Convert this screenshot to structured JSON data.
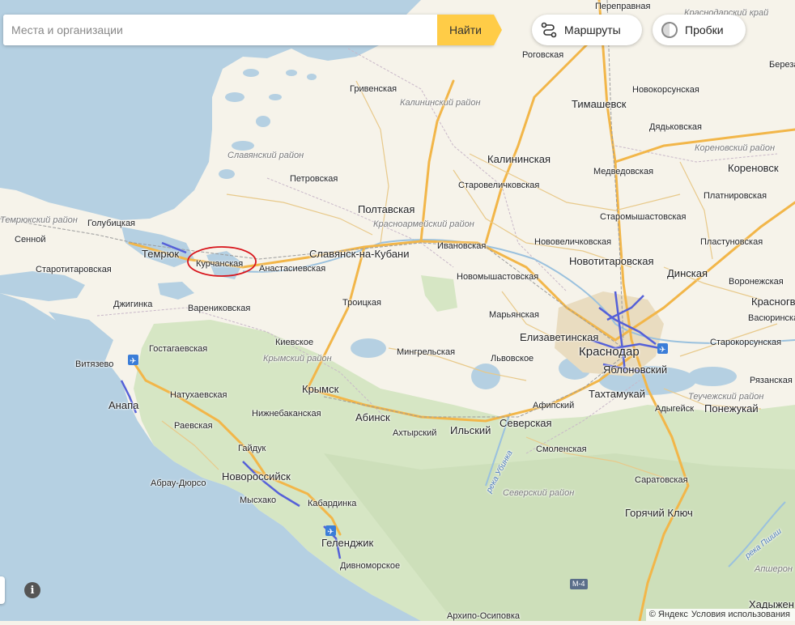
{
  "search": {
    "placeholder": "Места и организации",
    "button_label": "Найти"
  },
  "controls": {
    "routes_label": "Маршруты",
    "traffic_label": "Пробки",
    "routes_icon": "routes-icon",
    "traffic_icon": "traffic-icon",
    "info_icon": "info-icon"
  },
  "footer": {
    "copyright": "© Яндекс",
    "terms": "Условия использования"
  },
  "colors": {
    "water": "#b5d0e2",
    "land": "#f6f3ea",
    "forest": "#d6e6c4",
    "road_major": "#f2b649",
    "road_minor": "#ffffff",
    "city_area": "#e9dcc0",
    "traffic": "#5560d8",
    "marker": "#d8141b"
  },
  "annotation": {
    "type": "hand-drawn red ellipse",
    "target": "Курчанская"
  },
  "labels": {
    "perepravnaya": "Переправная",
    "krasnodarsky_kray": "Краснодарский край",
    "rogovskaya": "Роговская",
    "grivenskaya": "Гривенская",
    "kalininsky_rayon": "Калининский район",
    "timashevsk": "Тимашевск",
    "novokorsunskaya": "Новокорсунская",
    "dyadkovskaya": "Дядьковская",
    "berezan": "Березан",
    "slavyansky_rayon": "Славянский район",
    "kalininskaya": "Калининская",
    "medvedovskaya": "Медведовская",
    "korenovsky_rayon": "Кореновский район",
    "korenovsk": "Кореновск",
    "petrovskaya": "Петровская",
    "starovelichkovskaya": "Старовеличковская",
    "platnirovskaya": "Платнировская",
    "poltavskaya": "Полтавская",
    "krasnoarmeysky_rayon": "Красноармейский район",
    "staromyshastovskaya": "Старомышастовская",
    "temryuksky_rayon": "Темрюкский район",
    "golubitskaya": "Голубицкая",
    "sennoy": "Сенной",
    "temryuk": "Темрюк",
    "kurchanskaya": "Курчанская",
    "slavyansk": "Славянск-на-Кубани",
    "ivanovskaya": "Ивановская",
    "novovelichkovskaya": "Нововеличковская",
    "plastunovskaya": "Пластуновская",
    "starotitarovskaya": "Старотитаровская",
    "anastasievskaya": "Анастасиевская",
    "novotitarovskaya": "Новотитаровская",
    "dinskaya": "Динская",
    "novomyshastovskaya": "Новомышастовская",
    "voronezhskaya": "Воронежская",
    "krasnogvardeyskoe": "Красногвар",
    "dzhiginka": "Джигинка",
    "varenikovskaya": "Варениковская",
    "troitskaya": "Троицкая",
    "maryanskaya": "Марьянская",
    "vasyurinskaya": "Васюринская",
    "gostagaevskaya": "Гостагаевская",
    "kievskoe": "Киевское",
    "krymsky_rayon": "Крымский район",
    "elizavetinskaya": "Елизаветинская",
    "starokorsunskaya": "Старокорсунская",
    "vityazevo": "Витязево",
    "mingrelskaya": "Мингрельская",
    "lvovskoe": "Львовское",
    "krasnodar": "Краснодар",
    "yablonovsky": "Яблоновский",
    "razanskaya": "Рязанская",
    "natukhaevskaya": "Натухаевская",
    "krymsk": "Крымск",
    "afipsky": "Афипский",
    "takhtamukay": "Тахтамукай",
    "tlyustenkhabl": "Теучежский район",
    "anapa": "Анапа",
    "nizhnebakanskaya": "Нижнебаканская",
    "abinsk": "Абинск",
    "severskaya": "Северская",
    "adygeysk": "Адыгейск",
    "ponezhukay": "Понежукай",
    "raevskaya": "Раевская",
    "akhtyrsky": "Ахтырский",
    "ilsky": "Ильский",
    "gaiduk": "Гайдук",
    "smolenskaya": "Смоленская",
    "ubinka": "река Убинка",
    "abrau": "Абрау-Дюрсо",
    "novorossiysk": "Новороссийск",
    "saratovskaya": "Саратовская",
    "seversky_rayon": "Северский район",
    "myskhako": "Мысхако",
    "kabardinka": "Кабардинка",
    "goryachy_klyuch": "Горячий Ключ",
    "gelendzhik": "Геленджик",
    "pshish": "река Пшиш",
    "divnomorskoe": "Дивноморское",
    "m4": "М-4",
    "apsheron": "Апшерон",
    "khadyzhensk": "Хадыжен",
    "arkhipo": "Архипо-Осиповка",
    "ubinka2": "река Убинка"
  }
}
